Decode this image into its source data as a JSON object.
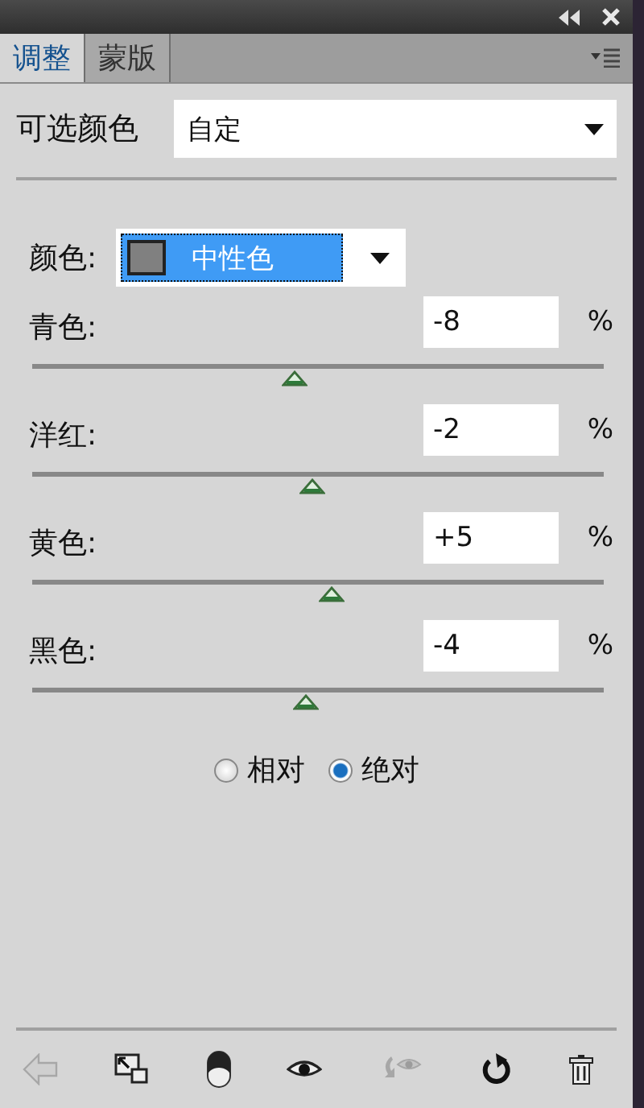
{
  "tabs": [
    {
      "label": "调整",
      "selected": true
    },
    {
      "label": "蒙版",
      "selected": false
    }
  ],
  "preset": {
    "label": "可选颜色",
    "value": "自定"
  },
  "colors": {
    "label": "颜色:",
    "value": "中性色"
  },
  "sliders": [
    {
      "name": "青色:",
      "value": "-8",
      "unit": "%",
      "level": 0.46
    },
    {
      "name": "洋红:",
      "value": "-2",
      "unit": "%",
      "level": 0.49
    },
    {
      "name": "黄色:",
      "value": "+5",
      "unit": "%",
      "level": 0.525
    },
    {
      "name": "黑色:",
      "value": "-4",
      "unit": "%",
      "level": 0.48
    }
  ],
  "method": [
    {
      "label": "相对",
      "selected": false
    },
    {
      "label": "绝对",
      "selected": true
    }
  ],
  "toolbar": [
    {
      "kind": "back",
      "disabled": true
    },
    {
      "kind": "expand",
      "disabled": false
    },
    {
      "kind": "clip",
      "disabled": false
    },
    {
      "kind": "eye",
      "disabled": false
    },
    {
      "kind": "previous",
      "disabled": true
    },
    {
      "kind": "reset",
      "disabled": false
    },
    {
      "kind": "trash",
      "disabled": false
    }
  ]
}
